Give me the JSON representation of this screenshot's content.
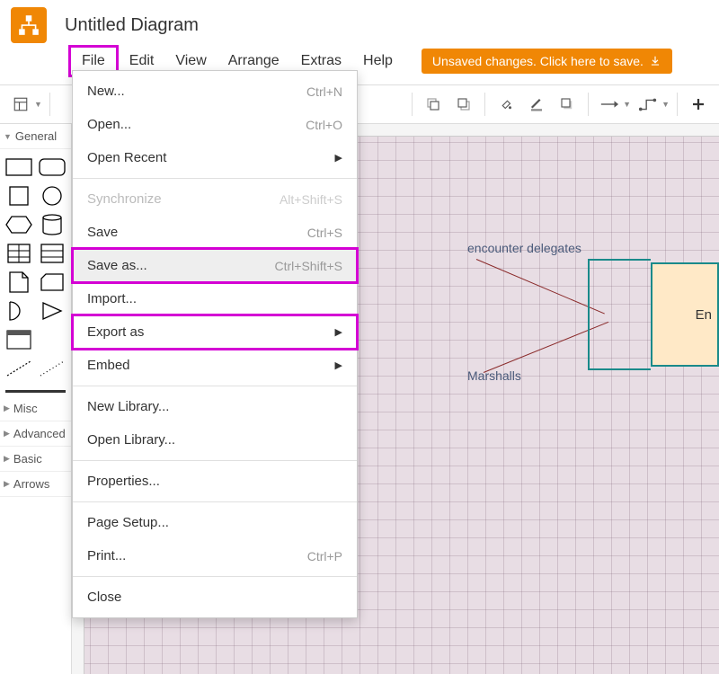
{
  "title": "Untitled Diagram",
  "menu": {
    "file": "File",
    "edit": "Edit",
    "view": "View",
    "arrange": "Arrange",
    "extras": "Extras",
    "help": "Help"
  },
  "save_banner": "Unsaved changes. Click here to save.",
  "sidebar": {
    "general": "General",
    "misc": "Misc",
    "advanced": "Advanced",
    "basic": "Basic",
    "arrows": "Arrows"
  },
  "file_menu": {
    "new": {
      "label": "New...",
      "shortcut": "Ctrl+N"
    },
    "open": {
      "label": "Open...",
      "shortcut": "Ctrl+O"
    },
    "open_recent": {
      "label": "Open Recent"
    },
    "synchronize": {
      "label": "Synchronize",
      "shortcut": "Alt+Shift+S"
    },
    "save": {
      "label": "Save",
      "shortcut": "Ctrl+S"
    },
    "save_as": {
      "label": "Save as...",
      "shortcut": "Ctrl+Shift+S"
    },
    "import": {
      "label": "Import..."
    },
    "export_as": {
      "label": "Export as"
    },
    "embed": {
      "label": "Embed"
    },
    "new_library": {
      "label": "New Library..."
    },
    "open_library": {
      "label": "Open Library..."
    },
    "properties": {
      "label": "Properties..."
    },
    "page_setup": {
      "label": "Page Setup..."
    },
    "print": {
      "label": "Print...",
      "shortcut": "Ctrl+P"
    },
    "close": {
      "label": "Close"
    }
  },
  "canvas": {
    "label1": "encounter delegates",
    "label2": "Marshalls",
    "box_text": "En"
  }
}
